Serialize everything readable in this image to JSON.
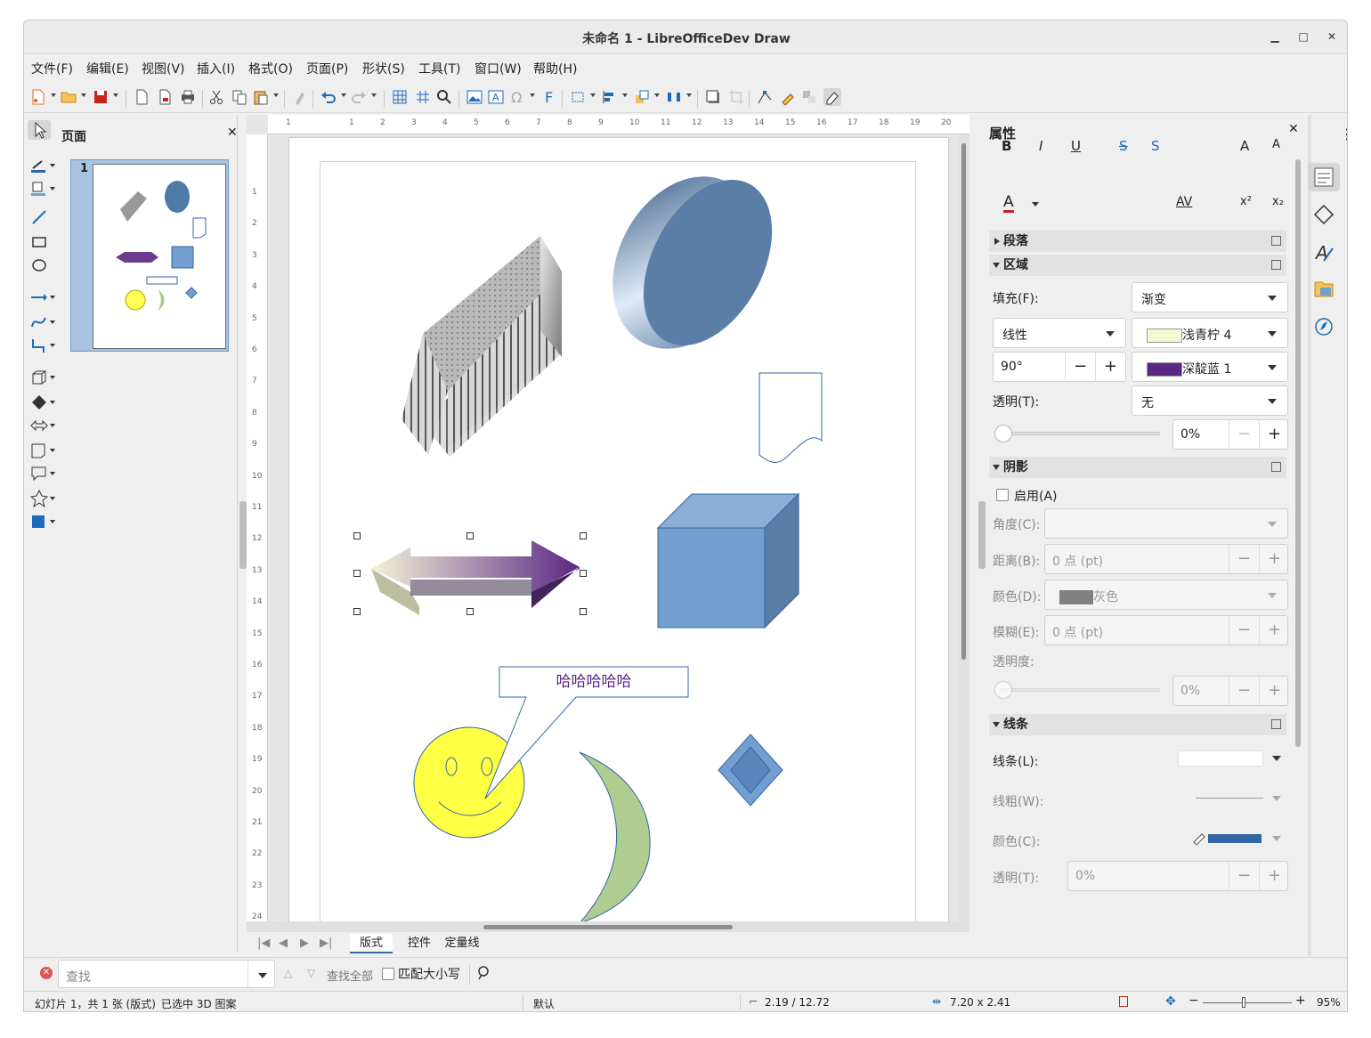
{
  "window": {
    "title": "未命名 1 - LibreOfficeDev Draw"
  },
  "menu": [
    "文件(F)",
    "编辑(E)",
    "视图(V)",
    "插入(I)",
    "格式(O)",
    "页面(P)",
    "形状(S)",
    "工具(T)",
    "窗口(W)",
    "帮助(H)"
  ],
  "pages_panel": {
    "title": "页面",
    "slide_number": "1"
  },
  "canvas": {
    "callout_text": "哈哈哈哈哈"
  },
  "ruler": {
    "h": [
      "1",
      "1",
      "2",
      "3",
      "4",
      "5",
      "6",
      "7",
      "8",
      "9",
      "10",
      "11",
      "12",
      "13",
      "14",
      "15",
      "16",
      "17",
      "18",
      "19",
      "20"
    ],
    "v": [
      "1",
      "2",
      "3",
      "4",
      "5",
      "6",
      "7",
      "8",
      "9",
      "10",
      "11",
      "12",
      "13",
      "14",
      "15",
      "16",
      "17",
      "18",
      "19",
      "20",
      "21",
      "22",
      "23",
      "24"
    ]
  },
  "bottom_tabs": [
    "版式",
    "控件",
    "定量线"
  ],
  "sidebar": {
    "title": "属性",
    "sections": {
      "paragraph": "段落",
      "area": "区域",
      "shadow": "阴影",
      "line": "线条"
    },
    "area": {
      "fill_label": "填充(F):",
      "fill_value": "渐变",
      "gradient_type": "线性",
      "color_from": "浅青柠 4",
      "color_to": "深靛蓝 1",
      "angle": "90°",
      "transparency_label": "透明(T):",
      "transparency_value": "无",
      "transparency_percent": "0%"
    },
    "shadow": {
      "enable_label": "启用(A)",
      "angle_label": "角度(C):",
      "distance_label": "距离(B):",
      "distance_value": "0 点 (pt)",
      "color_label": "颜色(D):",
      "color_value": "灰色",
      "blur_label": "模糊(E):",
      "blur_value": "0 点 (pt)",
      "transparency_label": "透明度:",
      "transparency_value": "0%"
    },
    "line": {
      "line_label": "线条(L):",
      "width_label": "线粗(W):",
      "color_label": "颜色(C):",
      "transparency_label": "透明(T):",
      "transparency_value": "0%"
    },
    "colors": {
      "lime": "#f4f9d4",
      "indigo": "#5b2784",
      "gray": "#808080",
      "line_blue": "#3465a4"
    }
  },
  "findbar": {
    "placeholder": "查找",
    "find_all": "查找全部",
    "match_case": "匹配大小写"
  },
  "status": {
    "slide": "幻灯片 1，共 1 张 (版式)",
    "selection": "已选中 3D 图案",
    "layout": "默认",
    "position": "2.19 / 12.72",
    "size": "7.20 x 2.41",
    "zoom": "95%"
  }
}
